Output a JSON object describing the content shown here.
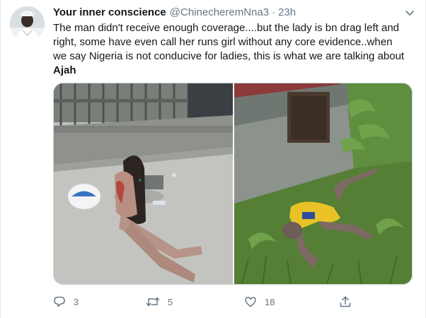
{
  "tweet": {
    "author": {
      "display_name": "Your inner conscience",
      "handle": "@ChinecheremNna3"
    },
    "separator": "·",
    "time": "23h",
    "text": "The man didn't receive enough coverage....but the lady is bn drag left and right, some have even call her runs girl without any core evidence..when we say Nigeria is not conducive for ladies, this is what we are talking about",
    "place": "Ajah",
    "media": [
      {
        "icon": "photo-woman-street"
      },
      {
        "icon": "photo-man-grass"
      }
    ],
    "actions": {
      "reply_count": "3",
      "retweet_count": "5",
      "like_count": "18"
    },
    "colors": {
      "icon_gray": "#657786",
      "text": "#14171a",
      "border": "#e6ecf0"
    }
  }
}
